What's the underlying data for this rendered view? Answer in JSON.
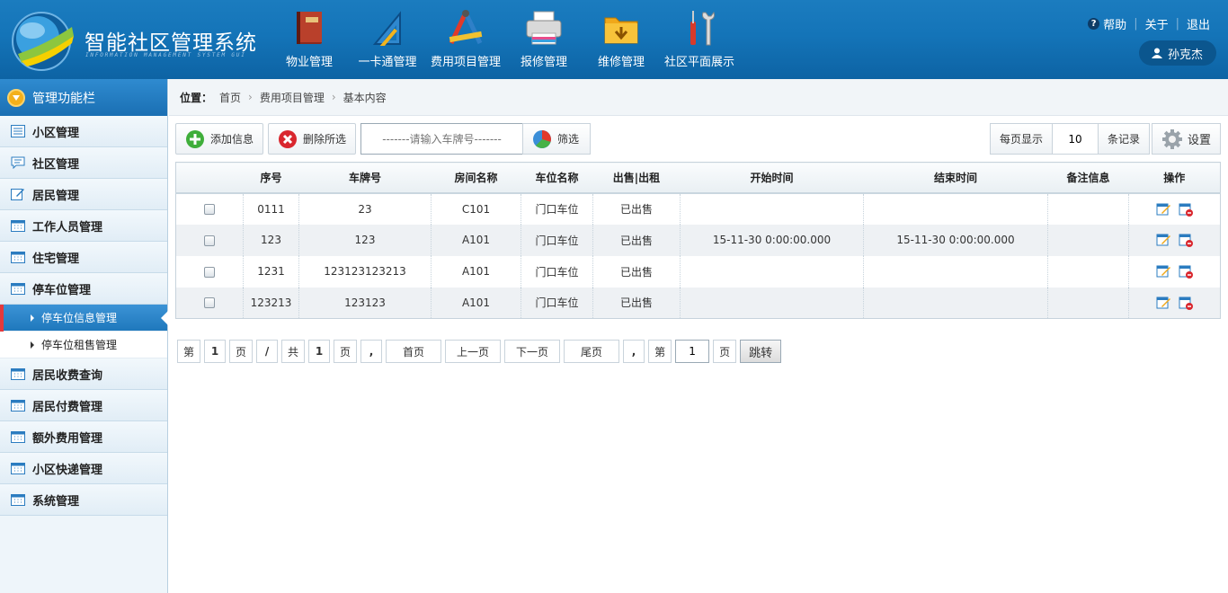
{
  "header": {
    "title": "智能社区管理系统",
    "subtitle": "INFORMATION MANAGEMENT SYSTEM GUI",
    "nav": [
      {
        "label": "物业管理",
        "icon": "book-icon"
      },
      {
        "label": "一卡通管理",
        "icon": "triangle-ruler-icon"
      },
      {
        "label": "费用项目管理",
        "icon": "drafting-tools-icon"
      },
      {
        "label": "报修管理",
        "icon": "printer-icon"
      },
      {
        "label": "维修管理",
        "icon": "folder-download-icon"
      },
      {
        "label": "社区平面展示",
        "icon": "tools-icon"
      }
    ],
    "help": "帮助",
    "about": "关于",
    "logout": "退出",
    "user": "孙克杰"
  },
  "sidebar": {
    "title": "管理功能栏",
    "items_top": [
      "小区管理",
      "社区管理",
      "居民管理",
      "工作人员管理",
      "住宅管理",
      "停车位管理"
    ],
    "subitems": [
      "停车位信息管理",
      "停车位租售管理"
    ],
    "items_bottom": [
      "居民收费查询",
      "居民付费管理",
      "额外费用管理",
      "小区快递管理",
      "系统管理"
    ]
  },
  "breadcrumb": {
    "label": "位置：",
    "items": [
      "首页",
      "费用项目管理",
      "基本内容"
    ]
  },
  "toolbar": {
    "add": "添加信息",
    "delete": "删除所选",
    "search_placeholder": "-------请输入车牌号-------",
    "filter": "筛选",
    "per_page_label": "每页显示",
    "per_page_value": "10",
    "records_label": "条记录",
    "settings": "设置"
  },
  "table": {
    "columns": [
      "",
      "序号",
      "车牌号",
      "房间名称",
      "车位名称",
      "出售|出租",
      "开始时间",
      "结束时间",
      "备注信息",
      "操作"
    ],
    "rows": [
      {
        "id": "0111",
        "plate": "23",
        "room": "C101",
        "spot": "门口车位",
        "status": "已出售",
        "start": "",
        "end": "",
        "note": ""
      },
      {
        "id": "123",
        "plate": "123",
        "room": "A101",
        "spot": "门口车位",
        "status": "已出售",
        "start": "15-11-30 0:00:00.000",
        "end": "15-11-30 0:00:00.000",
        "note": ""
      },
      {
        "id": "1231",
        "plate": "123123123213",
        "room": "A101",
        "spot": "门口车位",
        "status": "已出售",
        "start": "",
        "end": "",
        "note": ""
      },
      {
        "id": "123213",
        "plate": "123123",
        "room": "A101",
        "spot": "门口车位",
        "status": "已出售",
        "start": "",
        "end": "",
        "note": ""
      }
    ]
  },
  "pager": {
    "di": "第",
    "current": "1",
    "ye": "页",
    "slash": "/",
    "gong": "共",
    "total": "1",
    "comma": ",",
    "first": "首页",
    "prev": "上一页",
    "next": "下一页",
    "last": "尾页",
    "goto_value": "1",
    "jump": "跳转"
  }
}
